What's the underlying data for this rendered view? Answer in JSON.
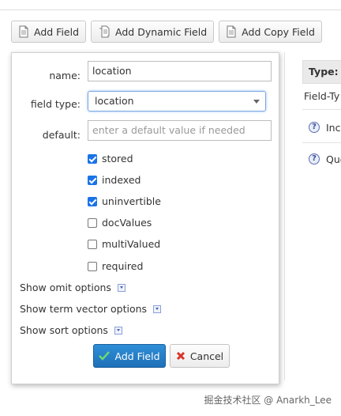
{
  "toolbar": {
    "add_field": "Add Field",
    "add_dynamic_field": "Add Dynamic Field",
    "add_copy_field": "Add Copy Field"
  },
  "background": {
    "type_header": "Type:",
    "field_type_label": "Field-Ty",
    "row1": "Inc",
    "row2": "Que"
  },
  "form": {
    "name_label": "name:",
    "name_value": "location",
    "field_type_label": "field type:",
    "field_type_value": "location",
    "default_label": "default:",
    "default_placeholder": "enter a default value if needed",
    "checkboxes": [
      {
        "label": "stored",
        "checked": true
      },
      {
        "label": "indexed",
        "checked": true
      },
      {
        "label": "uninvertible",
        "checked": true
      },
      {
        "label": "docValues",
        "checked": false
      },
      {
        "label": "multiValued",
        "checked": false
      },
      {
        "label": "required",
        "checked": false
      }
    ],
    "show_omit": "Show omit options",
    "show_term_vector": "Show term vector options",
    "show_sort": "Show sort options",
    "add_button": "Add Field",
    "cancel_button": "Cancel"
  },
  "watermark": "掘金技术社区 @ Anarkh_Lee",
  "colors": {
    "primary_button": "#1e70b8",
    "checkbox_checked": "#1a73e8",
    "cancel_icon": "#d9342b",
    "add_icon": "#6fdc6f"
  }
}
